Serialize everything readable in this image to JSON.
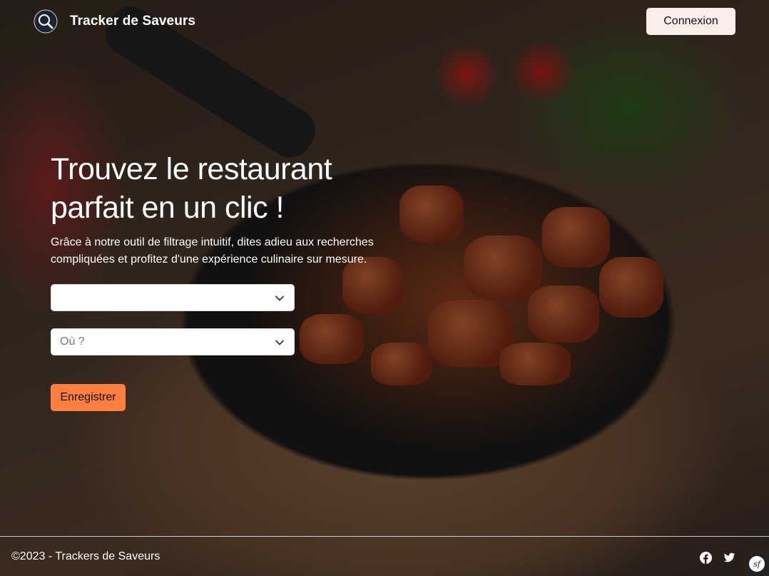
{
  "header": {
    "brand": "Tracker de Saveurs",
    "logo_icon": "magnifier-logo-icon",
    "login_label": "Connexion"
  },
  "hero": {
    "title": "Trouvez le restaurant parfait en un clic !",
    "lead": "Grâce à notre outil de filtrage intuitif, dites adieu aux recherches compliquées et profitez d'une expérience culinaire sur mesure."
  },
  "form": {
    "cuisine_select": {
      "value": ""
    },
    "location_select": {
      "placeholder": "Où ?"
    },
    "submit_label": "Enregistrer"
  },
  "footer": {
    "copyright": "©2023 - Trackers de Saveurs",
    "social_icons": [
      "facebook-icon",
      "twitter-icon"
    ],
    "symfony_badge": "sf"
  },
  "colors": {
    "accent": "#fd7e3f",
    "login_bg": "#fbeeea",
    "text": "#ffffff"
  }
}
